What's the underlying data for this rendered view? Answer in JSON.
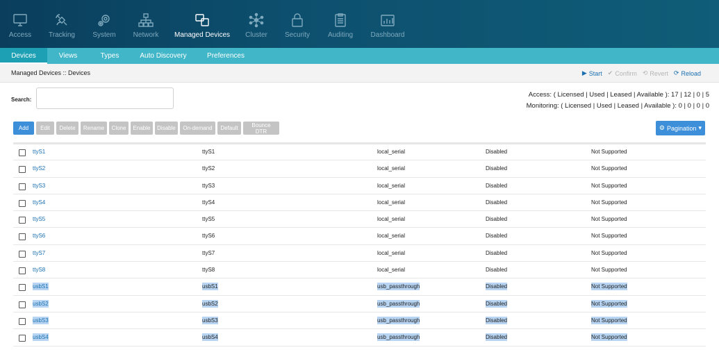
{
  "topnav": {
    "items": [
      {
        "label": "Access",
        "icon": "monitor-icon",
        "active": false
      },
      {
        "label": "Tracking",
        "icon": "satellite-icon",
        "active": false
      },
      {
        "label": "System",
        "icon": "gears-icon",
        "active": false
      },
      {
        "label": "Network",
        "icon": "network-icon",
        "active": false
      },
      {
        "label": "Managed Devices",
        "icon": "devices-icon",
        "active": true
      },
      {
        "label": "Cluster",
        "icon": "cluster-icon",
        "active": false
      },
      {
        "label": "Security",
        "icon": "lock-icon",
        "active": false
      },
      {
        "label": "Auditing",
        "icon": "clipboard-icon",
        "active": false
      },
      {
        "label": "Dashboard",
        "icon": "dashboard-icon",
        "active": false
      }
    ]
  },
  "subnav": {
    "tabs": [
      {
        "label": "Devices",
        "active": true
      },
      {
        "label": "Views",
        "active": false
      },
      {
        "label": "Types",
        "active": false
      },
      {
        "label": "Auto Discovery",
        "active": false
      },
      {
        "label": "Preferences",
        "active": false
      }
    ]
  },
  "breadcrumb": "Managed Devices :: Devices",
  "actions": {
    "start": "Start",
    "confirm": "Confirm",
    "revert": "Revert",
    "reload": "Reload"
  },
  "search": {
    "label": "Search:",
    "value": ""
  },
  "license": {
    "access": "Access: ( Licensed | Used | Leased | Available ): 17 | 12 | 0 | 5",
    "monitoring": "Monitoring: ( Licensed | Used | Leased | Available ): 0 | 0 | 0 | 0"
  },
  "toolbar": {
    "add": "Add",
    "edit": "Edit",
    "delete": "Delete",
    "rename": "Rename",
    "clone": "Clone",
    "enable": "Enable",
    "disable": "Disable",
    "on_demand": "On-demand",
    "default": "Default",
    "bounce_dtr": "Bounce DTR",
    "pagination": "Pagination"
  },
  "colors": {
    "nav_bg": "#0d4f6e",
    "subnav_bg": "#41b6c8",
    "primary_button": "#3d8fd9",
    "link": "#1a6fb0",
    "selection": "#b7d5f3"
  },
  "devices": [
    {
      "name": "ttyS1",
      "port": "ttyS1",
      "type": "local_serial",
      "status": "Disabled",
      "monitoring": "Not Supported",
      "selected": false
    },
    {
      "name": "ttyS2",
      "port": "ttyS2",
      "type": "local_serial",
      "status": "Disabled",
      "monitoring": "Not Supported",
      "selected": false
    },
    {
      "name": "ttyS3",
      "port": "ttyS3",
      "type": "local_serial",
      "status": "Disabled",
      "monitoring": "Not Supported",
      "selected": false
    },
    {
      "name": "ttyS4",
      "port": "ttyS4",
      "type": "local_serial",
      "status": "Disabled",
      "monitoring": "Not Supported",
      "selected": false
    },
    {
      "name": "ttyS5",
      "port": "ttyS5",
      "type": "local_serial",
      "status": "Disabled",
      "monitoring": "Not Supported",
      "selected": false
    },
    {
      "name": "ttyS6",
      "port": "ttyS6",
      "type": "local_serial",
      "status": "Disabled",
      "monitoring": "Not Supported",
      "selected": false
    },
    {
      "name": "ttyS7",
      "port": "ttyS7",
      "type": "local_serial",
      "status": "Disabled",
      "monitoring": "Not Supported",
      "selected": false
    },
    {
      "name": "ttyS8",
      "port": "ttyS8",
      "type": "local_serial",
      "status": "Disabled",
      "monitoring": "Not Supported",
      "selected": false
    },
    {
      "name": "usbS1",
      "port": "usbS1",
      "type": "usb_passthrough",
      "status": "Disabled",
      "monitoring": "Not Supported",
      "selected": true
    },
    {
      "name": "usbS2",
      "port": "usbS2",
      "type": "usb_passthrough",
      "status": "Disabled",
      "monitoring": "Not Supported",
      "selected": true
    },
    {
      "name": "usbS3",
      "port": "usbS3",
      "type": "usb_passthrough",
      "status": "Disabled",
      "monitoring": "Not Supported",
      "selected": true
    },
    {
      "name": "usbS4",
      "port": "usbS4",
      "type": "usb_passthrough",
      "status": "Disabled",
      "monitoring": "Not Supported",
      "selected": true
    }
  ]
}
